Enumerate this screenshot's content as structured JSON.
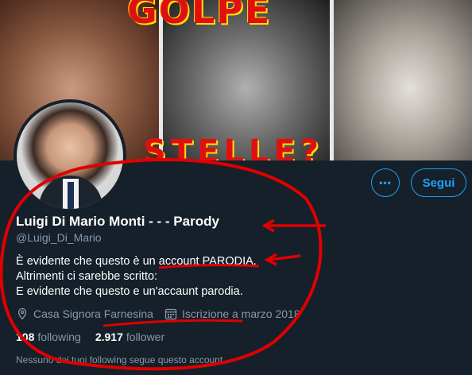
{
  "banner": {
    "top_text": "GOLPE",
    "bottom_text": "STELLE?"
  },
  "header": {
    "more_button_label": "•••",
    "follow_button_label": "Segui"
  },
  "profile": {
    "display_name": "Luigi Di Mario Monti - - - Parody",
    "handle": "@Luigi_Di_Mario",
    "bio_lines": [
      "È evidente che questo è un account PARODIA.",
      "Altrimenti ci sarebbe scritto:",
      "E evidente che questo e un'accaunt parodia."
    ],
    "location": "Casa Signora Farnesina",
    "joined": "Iscrizione a marzo 2018",
    "following_count": "108",
    "following_label": "following",
    "followers_count": "2.917",
    "followers_label": "follower",
    "mutuals_notice": "Nessuno dei tuoi following segue questo account"
  },
  "icons": {
    "location": "location-pin-icon",
    "calendar": "calendar-icon"
  },
  "colors": {
    "background": "#15202b",
    "accent": "#1da1f2",
    "muted_text": "#8899a6",
    "annotation": "#e00000"
  }
}
